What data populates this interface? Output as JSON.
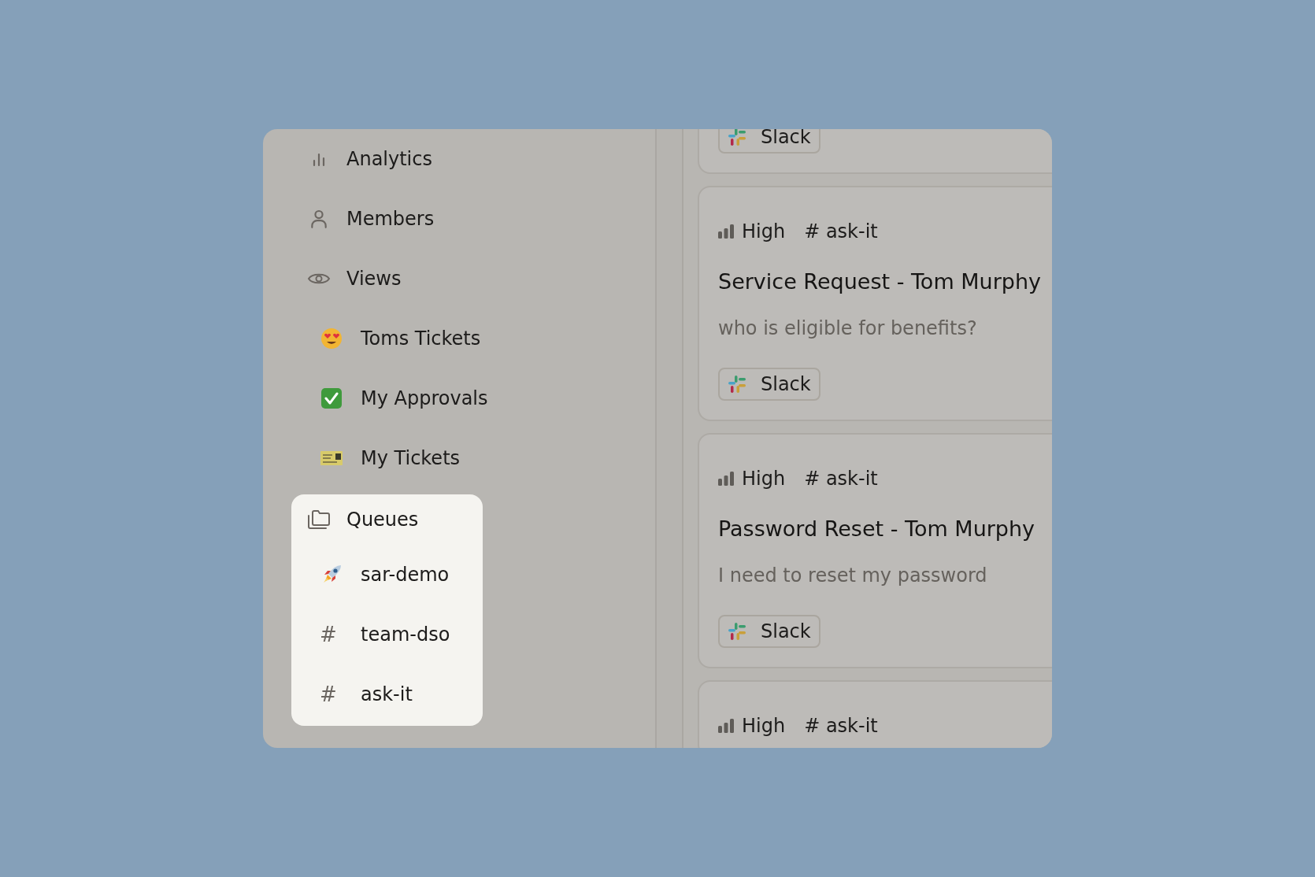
{
  "sidebar": {
    "items": [
      {
        "label": "Analytics",
        "selected": false
      },
      {
        "label": "Members",
        "selected": false
      },
      {
        "label": "Views",
        "selected": false,
        "children": [
          {
            "label": "Toms Tickets"
          },
          {
            "label": "My Approvals"
          },
          {
            "label": "My Tickets"
          }
        ]
      },
      {
        "label": "Queues",
        "selected": true,
        "children": [
          {
            "label": "sar-demo"
          },
          {
            "label": "team-dso",
            "glyph": "#"
          },
          {
            "label": "ask-it",
            "glyph": "#"
          }
        ]
      }
    ]
  },
  "tickets": [
    {
      "source": "Slack"
    },
    {
      "priority": "High",
      "channel": "# ask-it",
      "title": "Service Request - Tom Murphy",
      "description": "who is eligible for benefits?",
      "source": "Slack"
    },
    {
      "priority": "High",
      "channel": "# ask-it",
      "title": "Password Reset - Tom Murphy",
      "description": "I need to reset my password",
      "source": "Slack"
    },
    {
      "priority": "High",
      "channel": "# ask-it"
    }
  ]
}
